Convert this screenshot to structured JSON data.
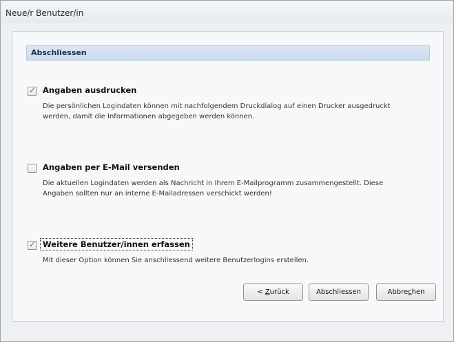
{
  "window": {
    "title": "Neue/r Benutzer/in"
  },
  "section": {
    "title": "Abschliessen"
  },
  "options": [
    {
      "label": "Angaben ausdrucken",
      "checked": true,
      "description_line1": "Die persönlichen Logindaten können mit nachfolgendem Druckdialog auf einen Drucker ausgedruckt",
      "description_line2": "werden, damit die Informationen abgegeben werden können."
    },
    {
      "label": "Angaben per E-Mail versenden",
      "checked": false,
      "description_line1": "Die aktuellen Logindaten werden als Nachricht in Ihrem E-Mailprogramm zusammengestellt. Diese",
      "description_line2": "Angaben sollten nur an interne E-Mailadressen verschickt werden!"
    },
    {
      "label": "Weitere Benutzer/innen erfassen",
      "checked": true,
      "description_line1": "Mit dieser Option können Sie anschliessend weitere Benutzerlogins erstellen.",
      "description_line2": ""
    }
  ],
  "buttons": {
    "back_prefix": "< ",
    "back_mnemonic": "Z",
    "back_rest": "urück",
    "finish": "Abschliessen",
    "cancel_before": "Abbre",
    "cancel_mnemonic": "c",
    "cancel_after": "hen"
  },
  "colors": {
    "section_header": "#cbdaee",
    "check_mark": "#5a6f8a"
  }
}
